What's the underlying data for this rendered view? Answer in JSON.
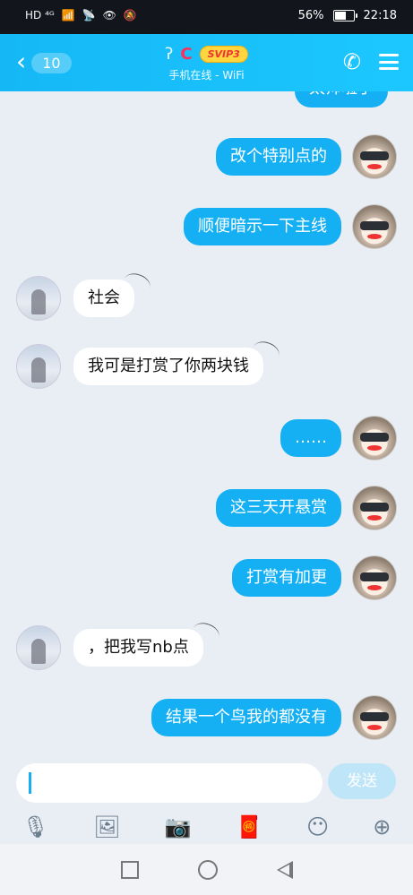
{
  "status": {
    "left": "HD  ⁴ᴳ",
    "battery": "56%",
    "time": "22:18"
  },
  "header": {
    "unread": "10",
    "contact": "C",
    "vip": "SVIP3",
    "subtitle": "手机在线 - WiFi"
  },
  "messages": [
    {
      "text": "太帅啦了",
      "dir": "out"
    },
    {
      "text": "改个特别点的",
      "dir": "out"
    },
    {
      "text": "顺便暗示一下主线",
      "dir": "out"
    },
    {
      "text": "社会",
      "dir": "in"
    },
    {
      "text": "我可是打赏了你两块钱",
      "dir": "in"
    },
    {
      "text": "……",
      "dir": "out"
    },
    {
      "text": "这三天开悬赏",
      "dir": "out"
    },
    {
      "text": "打赏有加更",
      "dir": "out"
    },
    {
      "text": "，把我写nb点",
      "dir": "in"
    },
    {
      "text": "结果一个鸟我的都没有",
      "dir": "out"
    }
  ],
  "input": {
    "value": "",
    "send_label": "发送"
  },
  "toolbar_icons": [
    "microphone-icon",
    "image-icon",
    "camera-icon",
    "red-packet-icon",
    "emoji-icon",
    "plus-icon"
  ]
}
